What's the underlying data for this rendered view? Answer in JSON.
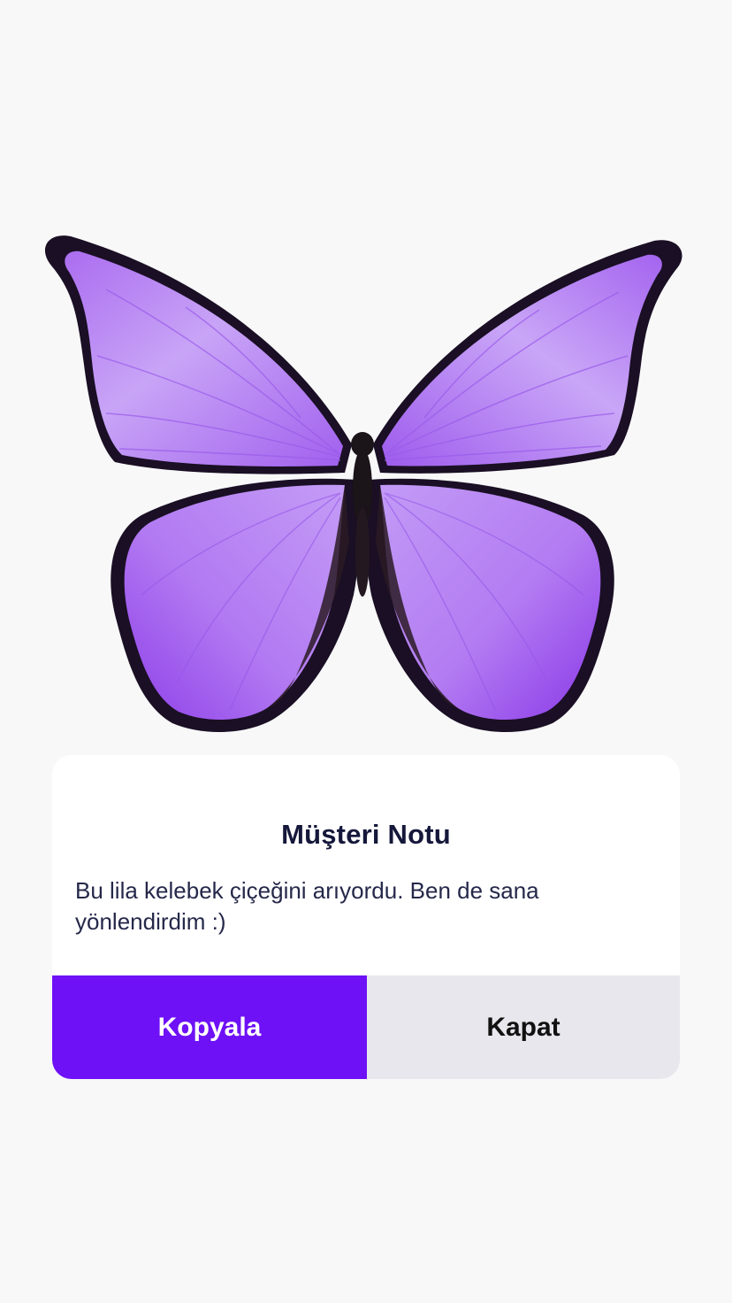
{
  "image": {
    "subject": "butterfly-icon",
    "colors": {
      "wing_light": "#c7a1f7",
      "wing_mid": "#ad73f1",
      "wing_deep": "#8c3ee8",
      "wing_border": "#1a0f24",
      "body": "#1b1418"
    }
  },
  "dialog": {
    "title": "Müşteri Notu",
    "message": "Bu lila kelebek çiçeğini arıyordu. Ben de sana yönlendirdim :)",
    "copy_label": "Kopyala",
    "close_label": "Kapat"
  },
  "colors": {
    "background": "#f8f8f9",
    "primary": "#6e11f6",
    "secondary": "#e7e7ed",
    "title_text": "#15183a"
  }
}
